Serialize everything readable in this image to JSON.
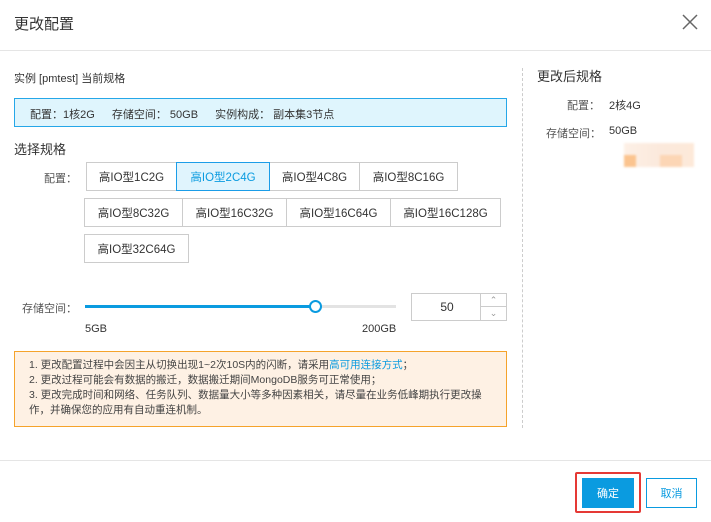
{
  "dialog": {
    "title": "更改配置",
    "close_icon": "close-icon"
  },
  "current": {
    "heading": "实例 [pmtest] 当前规格",
    "config": "配置：1核2G",
    "storage": "存储空间： 50GB",
    "composition": "实例构成： 副本集3节点"
  },
  "select": {
    "heading": "选择规格",
    "config_label": "配置：",
    "options": [
      "高IO型1C2G",
      "高IO型2C4G",
      "高IO型4C8G",
      "高IO型8C16G",
      "高IO型8C32G",
      "高IO型16C32G",
      "高IO型16C64G",
      "高IO型16C128G",
      "高IO型32C64G"
    ],
    "selected": "高IO型2C4G"
  },
  "storage": {
    "label": "存储空间：",
    "value": "50",
    "min_label": "5GB",
    "max_label": "200GB",
    "min": 5,
    "max": 200,
    "current": 50
  },
  "notice": {
    "line1_prefix": "1. 更改配置过程中会因主从切换出现1~2次10S内的闪断，请采用",
    "line1_link": "高可用连接方式",
    "line1_suffix": "；",
    "line2": "2. 更改过程可能会有数据的搬迁，数据搬迁期间MongoDB服务可正常使用；",
    "line3": "3. 更改完成时间和网络、任务队列、数据量大小等多种因素相关，请尽量在业务低峰期执行更改操作，并确保您的应用有自动重连机制。"
  },
  "after": {
    "heading": "更改后规格",
    "config_label": "配置：",
    "config_value": "2核4G",
    "storage_label": "存储空间：",
    "storage_value": "50GB"
  },
  "footer": {
    "confirm": "确定",
    "cancel": "取消"
  },
  "colors": {
    "accent": "#0a9be0",
    "highlight": "#e53935"
  }
}
